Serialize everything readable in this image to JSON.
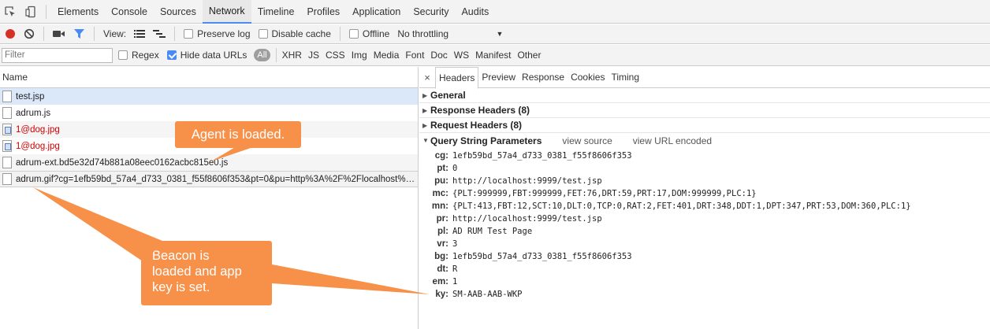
{
  "tabs": [
    "Elements",
    "Console",
    "Sources",
    "Network",
    "Timeline",
    "Profiles",
    "Application",
    "Security",
    "Audits"
  ],
  "active_tab": "Network",
  "toolbar": {
    "view_label": "View:",
    "preserve_log": "Preserve log",
    "disable_cache": "Disable cache",
    "offline": "Offline",
    "throttling": "No throttling"
  },
  "filter": {
    "placeholder": "Filter",
    "regex": "Regex",
    "hide_data_urls": "Hide data URLs",
    "types": [
      "All",
      "XHR",
      "JS",
      "CSS",
      "Img",
      "Media",
      "Font",
      "Doc",
      "WS",
      "Manifest",
      "Other"
    ]
  },
  "requests": {
    "header": "Name",
    "rows": [
      "test.jsp",
      "adrum.js",
      "1@dog.jpg",
      "1@dog.jpg",
      "adrum-ext.bd5e32d74b881a08eec0162acbc815e0.js",
      "adrum.gif?cg=1efb59bd_57a4_d733_0381_f55f8606f353&pt=0&pu=http%3A%2F%2Flocalhost%3A99..."
    ]
  },
  "detail": {
    "close": "×",
    "tabs": [
      "Headers",
      "Preview",
      "Response",
      "Cookies",
      "Timing"
    ],
    "sections": [
      "General",
      "Response Headers (8)",
      "Request Headers (8)",
      "Query String Parameters"
    ],
    "view_source": "view source",
    "view_url_encoded": "view URL encoded",
    "params": [
      {
        "k": "cg:",
        "v": "1efb59bd_57a4_d733_0381_f55f8606f353"
      },
      {
        "k": "pt:",
        "v": "0"
      },
      {
        "k": "pu:",
        "v": "http://localhost:9999/test.jsp"
      },
      {
        "k": "mc:",
        "v": "{PLT:999999,FBT:999999,FET:76,DRT:59,PRT:17,DOM:999999,PLC:1}"
      },
      {
        "k": "mn:",
        "v": "{PLT:413,FBT:12,SCT:10,DLT:0,TCP:0,RAT:2,FET:401,DRT:348,DDT:1,DPT:347,PRT:53,DOM:360,PLC:1}"
      },
      {
        "k": "pr:",
        "v": "http://localhost:9999/test.jsp"
      },
      {
        "k": "pl:",
        "v": "AD RUM Test Page"
      },
      {
        "k": "vr:",
        "v": "3"
      },
      {
        "k": "bg:",
        "v": "1efb59bd_57a4_d733_0381_f55f8606f353"
      },
      {
        "k": "dt:",
        "v": "R"
      },
      {
        "k": "em:",
        "v": "1"
      },
      {
        "k": "ky:",
        "v": "SM-AAB-AAB-WKP"
      }
    ]
  },
  "callouts": {
    "agent": "Agent is loaded.",
    "beacon_line1": "Beacon is",
    "beacon_line2": "loaded and app",
    "beacon_line3": "key is set."
  },
  "colors": {
    "accent": "#4a8af4",
    "record": "#d93025",
    "error_text": "#d50000",
    "callout": "#f7914a",
    "selected_row": "#dbe8fa"
  }
}
